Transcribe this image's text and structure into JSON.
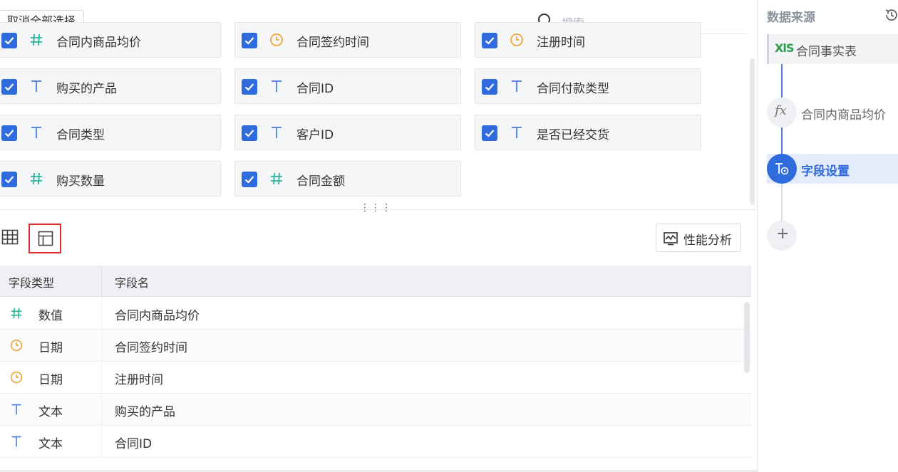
{
  "toolbar": {
    "deselect_all_label": "取消全部选择",
    "search_placeholder": "搜索"
  },
  "fields": [
    {
      "label": "合同内商品均价",
      "type_icon": "number-hash-icon",
      "checked": true
    },
    {
      "label": "合同签约时间",
      "type_icon": "clock-icon",
      "checked": true
    },
    {
      "label": "注册时间",
      "type_icon": "clock-icon",
      "checked": true
    },
    {
      "label": "购买的产品",
      "type_icon": "text-t-icon",
      "checked": true
    },
    {
      "label": "合同ID",
      "type_icon": "text-t-icon",
      "checked": true
    },
    {
      "label": "合同付款类型",
      "type_icon": "text-t-icon",
      "checked": true
    },
    {
      "label": "合同类型",
      "type_icon": "text-t-icon",
      "checked": true
    },
    {
      "label": "客户ID",
      "type_icon": "text-t-icon",
      "checked": true
    },
    {
      "label": "是否已经交货",
      "type_icon": "text-t-icon",
      "checked": true
    },
    {
      "label": "购买数量",
      "type_icon": "number-hash-icon",
      "checked": true
    },
    {
      "label": "合同金额",
      "type_icon": "number-hash-icon",
      "checked": true
    }
  ],
  "view": {
    "perf_button_label": "性能分析"
  },
  "table": {
    "headers": [
      "字段类型",
      "字段名"
    ],
    "rows": [
      {
        "type_icon": "number-hash-icon",
        "type": "数值",
        "name": "合同内商品均价"
      },
      {
        "type_icon": "clock-icon",
        "type": "日期",
        "name": "合同签约时间"
      },
      {
        "type_icon": "clock-icon",
        "type": "日期",
        "name": "注册时间"
      },
      {
        "type_icon": "text-t-icon",
        "type": "文本",
        "name": "购买的产品"
      },
      {
        "type_icon": "text-t-icon",
        "type": "文本",
        "name": "合同ID"
      }
    ]
  },
  "right_panel": {
    "title": "数据来源",
    "source_icon_text": "XlS",
    "source_label": "合同事实表",
    "formula_icon_text": "fx",
    "formula_label": "合同内商品均价",
    "field_settings_label": "字段设置",
    "add_symbol": "+"
  },
  "colors": {
    "accent_blue": "#2f6bdc",
    "number_green": "#2bb39a",
    "date_orange": "#f0a43a",
    "text_blue": "#4a7fe0",
    "highlight_red": "#e02b2b"
  }
}
